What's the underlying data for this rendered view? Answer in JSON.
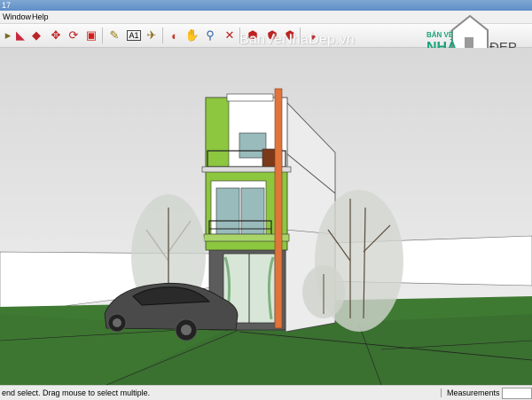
{
  "window": {
    "title_fragment": "17"
  },
  "menu": {
    "items": [
      "Window",
      "Help"
    ]
  },
  "toolbar": {
    "icons": [
      "select-icon",
      "eraser-icon",
      "paint-bucket-icon",
      "move-icon",
      "rotate-icon",
      "push-pull-icon",
      "tape-measure-icon",
      "text-icon",
      "dimension-icon",
      "orbit-icon",
      "pan-icon",
      "zoom-icon",
      "zoom-extents-icon",
      "get-models-icon",
      "share-model-icon",
      "components-icon",
      "ruby-icon"
    ]
  },
  "watermark": {
    "text": "BanVeNhaDep.vn"
  },
  "logo": {
    "top_text": "BẢN VẼ",
    "left_text": "NHÀ",
    "right_text": "ĐẸP",
    "brand_green": "#1aa37a"
  },
  "status": {
    "hint": "end select. Drag mouse to select multiple.",
    "measurements_label": "Measurements"
  },
  "colors": {
    "sky_top": "#dcdcdc",
    "ground": "#3e7a32",
    "accent_green": "#8dc63f"
  }
}
